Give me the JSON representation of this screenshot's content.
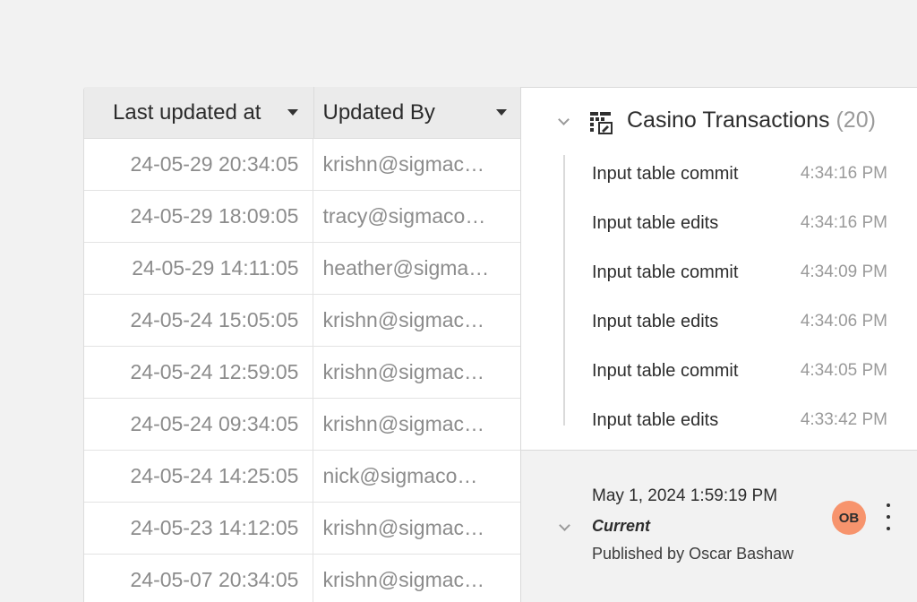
{
  "table": {
    "columns": [
      {
        "label": "Last updated at"
      },
      {
        "label": "Updated By"
      }
    ],
    "rows": [
      {
        "updated_at": "24-05-29 20:34:05",
        "updated_by": "krishn@sigmac…"
      },
      {
        "updated_at": "24-05-29 18:09:05",
        "updated_by": "tracy@sigmaco…"
      },
      {
        "updated_at": "24-05-29 14:11:05",
        "updated_by": "heather@sigma…"
      },
      {
        "updated_at": "24-05-24 15:05:05",
        "updated_by": "krishn@sigmac…"
      },
      {
        "updated_at": "24-05-24 12:59:05",
        "updated_by": "krishn@sigmac…"
      },
      {
        "updated_at": "24-05-24 09:34:05",
        "updated_by": "krishn@sigmac…"
      },
      {
        "updated_at": "24-05-24 14:25:05",
        "updated_by": "nick@sigmaco…"
      },
      {
        "updated_at": "24-05-23 14:12:05",
        "updated_by": "krishn@sigmac…"
      },
      {
        "updated_at": "24-05-07 20:34:05",
        "updated_by": "krishn@sigmac…"
      }
    ]
  },
  "history": {
    "group": {
      "title": "Casino Transactions",
      "count": "(20)",
      "icon": "input-table-icon",
      "events": [
        {
          "label": "Input table commit",
          "time": "4:34:16 PM"
        },
        {
          "label": "Input table edits",
          "time": "4:34:16 PM"
        },
        {
          "label": "Input table commit",
          "time": "4:34:09 PM"
        },
        {
          "label": "Input table edits",
          "time": "4:34:06 PM"
        },
        {
          "label": "Input table commit",
          "time": "4:34:05 PM"
        },
        {
          "label": "Input table edits",
          "time": "4:33:42 PM"
        }
      ]
    },
    "current": {
      "date": "May 1, 2024 1:59:19 PM",
      "status": "Current",
      "published_by": "Published by Oscar Bashaw",
      "avatar_initials": "OB",
      "avatar_color": "#f7946d"
    }
  }
}
